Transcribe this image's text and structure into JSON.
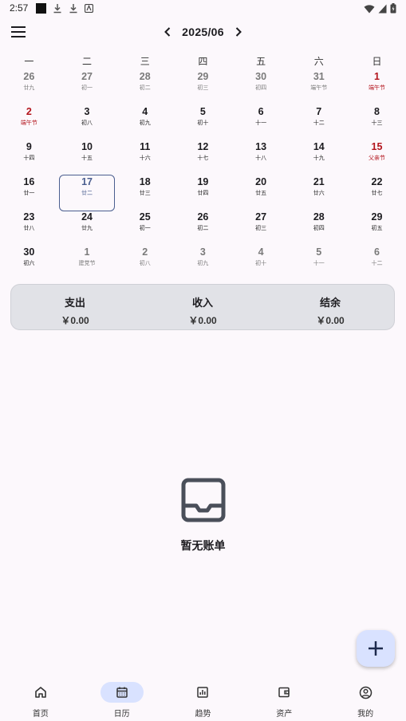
{
  "status_bar": {
    "time": "2:57"
  },
  "header": {
    "month": "2025/06"
  },
  "weekdays": [
    "一",
    "二",
    "三",
    "四",
    "五",
    "六",
    "日"
  ],
  "calendar": {
    "selected_day": "17",
    "rows": [
      [
        {
          "day": "26",
          "lunar": "廿九",
          "other": true
        },
        {
          "day": "27",
          "lunar": "初一",
          "other": true
        },
        {
          "day": "28",
          "lunar": "初二",
          "other": true
        },
        {
          "day": "29",
          "lunar": "初三",
          "other": true
        },
        {
          "day": "30",
          "lunar": "初四",
          "other": true
        },
        {
          "day": "31",
          "lunar": "端午节",
          "other": true
        },
        {
          "day": "1",
          "lunar": "端午节",
          "holiday": true
        }
      ],
      [
        {
          "day": "2",
          "lunar": "端午节",
          "holiday": true
        },
        {
          "day": "3",
          "lunar": "初八"
        },
        {
          "day": "4",
          "lunar": "初九"
        },
        {
          "day": "5",
          "lunar": "初十"
        },
        {
          "day": "6",
          "lunar": "十一"
        },
        {
          "day": "7",
          "lunar": "十二"
        },
        {
          "day": "8",
          "lunar": "十三"
        }
      ],
      [
        {
          "day": "9",
          "lunar": "十四"
        },
        {
          "day": "10",
          "lunar": "十五"
        },
        {
          "day": "11",
          "lunar": "十六"
        },
        {
          "day": "12",
          "lunar": "十七"
        },
        {
          "day": "13",
          "lunar": "十八"
        },
        {
          "day": "14",
          "lunar": "十九"
        },
        {
          "day": "15",
          "lunar": "父亲节",
          "holiday": true
        }
      ],
      [
        {
          "day": "16",
          "lunar": "廿一"
        },
        {
          "day": "17",
          "lunar": "廿二",
          "selected": true
        },
        {
          "day": "18",
          "lunar": "廿三"
        },
        {
          "day": "19",
          "lunar": "廿四"
        },
        {
          "day": "20",
          "lunar": "廿五"
        },
        {
          "day": "21",
          "lunar": "廿六"
        },
        {
          "day": "22",
          "lunar": "廿七"
        }
      ],
      [
        {
          "day": "23",
          "lunar": "廿八"
        },
        {
          "day": "24",
          "lunar": "廿九"
        },
        {
          "day": "25",
          "lunar": "初一"
        },
        {
          "day": "26",
          "lunar": "初二"
        },
        {
          "day": "27",
          "lunar": "初三"
        },
        {
          "day": "28",
          "lunar": "初四"
        },
        {
          "day": "29",
          "lunar": "初五"
        }
      ],
      [
        {
          "day": "30",
          "lunar": "初六"
        },
        {
          "day": "1",
          "lunar": "建党节",
          "other": true
        },
        {
          "day": "2",
          "lunar": "初八",
          "other": true
        },
        {
          "day": "3",
          "lunar": "初九",
          "other": true
        },
        {
          "day": "4",
          "lunar": "初十",
          "other": true
        },
        {
          "day": "5",
          "lunar": "十一",
          "other": true
        },
        {
          "day": "6",
          "lunar": "十二",
          "other": true
        }
      ]
    ]
  },
  "summary": {
    "expense_label": "支出",
    "expense_value": "￥0.00",
    "income_label": "收入",
    "income_value": "￥0.00",
    "balance_label": "结余",
    "balance_value": "￥0.00"
  },
  "empty": {
    "text": "暂无账单",
    "icon": "inbox-icon"
  },
  "fab": {
    "icon": "plus-icon"
  },
  "bottom_nav": [
    {
      "label": "首页",
      "icon": "home-icon",
      "name": "home"
    },
    {
      "label": "日历",
      "icon": "calendar-icon",
      "name": "calendar",
      "active": true
    },
    {
      "label": "趋势",
      "icon": "chart-icon",
      "name": "trend"
    },
    {
      "label": "资产",
      "icon": "wallet-icon",
      "name": "assets"
    },
    {
      "label": "我的",
      "icon": "account-icon",
      "name": "profile"
    }
  ],
  "colors": {
    "background": "#fcf8fc",
    "holiday": "#b3141c",
    "selected": "#4a5e8f",
    "accent_container": "#d9e2ff",
    "summary_card": "#e1e2e7"
  }
}
